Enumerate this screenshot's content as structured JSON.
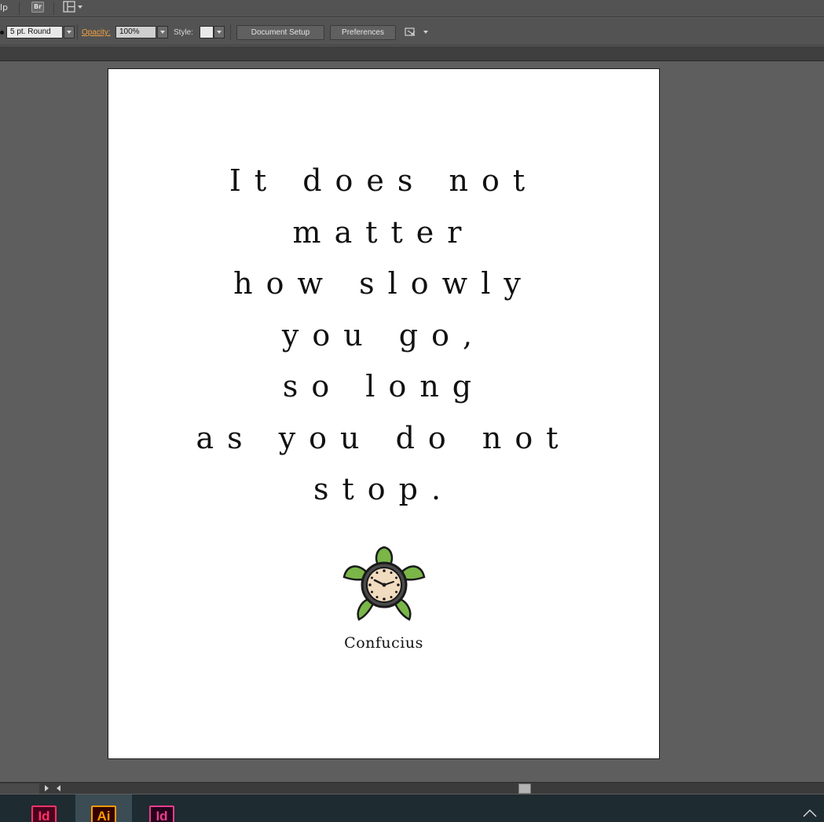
{
  "menubar": {
    "help_label": "lp",
    "bridge_label": "Br",
    "workspace_icon": "layout-grid-icon"
  },
  "controlbar": {
    "stroke_profile_value": "5 pt. Round",
    "opacity_label": "Opacity:",
    "opacity_value": "100%",
    "style_label": "Style:",
    "document_setup_label": "Document Setup",
    "preferences_label": "Preferences",
    "arrange_icon": "arrange-documents-icon"
  },
  "artboard": {
    "quote_lines": [
      "It does not",
      "matter",
      "how slowly",
      "you go,",
      "so long",
      "as you do not",
      "stop."
    ],
    "illustration": "turtle-clock-icon",
    "author": "Confucius"
  },
  "taskbar": {
    "apps": [
      {
        "label": "Id",
        "icon": "indesign-icon",
        "active": false
      },
      {
        "label": "Ai",
        "icon": "illustrator-icon",
        "active": true
      },
      {
        "label": "Id",
        "icon": "indesign-icon",
        "active": false
      }
    ]
  },
  "colors": {
    "accent_link": "#f0a040",
    "indesign": "#ff3366",
    "illustrator": "#ff9a00",
    "turtle_green": "#7ab648",
    "clock_face": "#f2dcc0"
  }
}
